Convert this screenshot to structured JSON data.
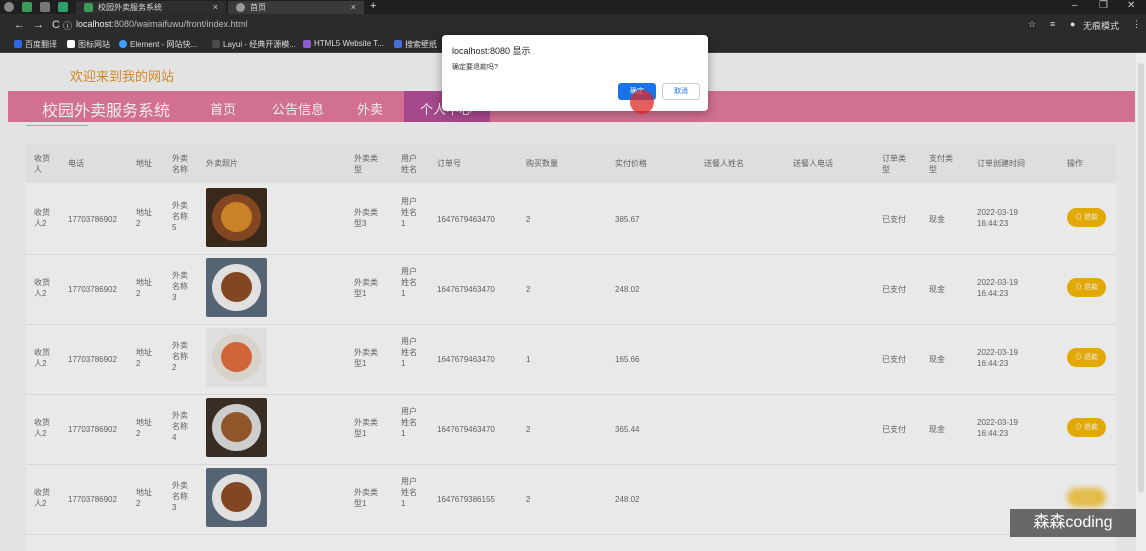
{
  "browser": {
    "tabs": [
      {
        "title": "校园外卖服务系统",
        "close": "×",
        "icon_color": "#3b9b5a"
      },
      {
        "title": "首页",
        "close": "×",
        "icon_color": "#999999"
      }
    ],
    "new_tab": "+",
    "url_host": "localhost",
    "url_rest": ":8080/waimaifuwu/front/index.html",
    "profile_label": "无痕模式",
    "window_controls": {
      "minimize": "–",
      "maximize": "❐",
      "close": "✕"
    },
    "bookmarks": [
      {
        "label": "百度翻译",
        "color": "#2d6ae3"
      },
      {
        "label": "图标网站",
        "color": "#ffffff"
      },
      {
        "label": "Element - 网站快...",
        "color": "#409eff"
      },
      {
        "label": "Layui - 经典开源模...",
        "color": "#4a4a4a"
      },
      {
        "label": "HTML5 Website T...",
        "color": "#8c5cd1"
      },
      {
        "label": "搜索壁纸",
        "color": "#4b6fd6"
      }
    ]
  },
  "page": {
    "welcome": "欢迎来到我的网站",
    "site_title": "校园外卖服务系统",
    "nav": [
      "首页",
      "公告信息",
      "外卖",
      "个人中心"
    ],
    "columns": [
      "收货人",
      "电话",
      "地址",
      "外卖名称",
      "外卖照片",
      "外卖类型",
      "用户姓名",
      "订单号",
      "购买数量",
      "实付价格",
      "送餐人姓名",
      "送餐人电话",
      "订单类型",
      "支付类型",
      "订单创建时间",
      "操作"
    ],
    "rows": [
      {
        "receiver": "收货人2",
        "phone": "17703786902",
        "address": "地址2",
        "name": "外卖名称5",
        "type": "外卖类型3",
        "user": "用户姓名1",
        "order_no": "1647679463470",
        "qty": "2",
        "price": "385.67",
        "order_type": "已支付",
        "pay_type": "现金",
        "date": "2022-03-19",
        "time": "16:44:23",
        "action": "退款",
        "photo_bg": "#3a2a1a",
        "plate": "#8a4a20",
        "food": "#d88a2a"
      },
      {
        "receiver": "收货人2",
        "phone": "17703786902",
        "address": "地址2",
        "name": "外卖名称3",
        "type": "外卖类型1",
        "user": "用户姓名1",
        "order_no": "1647679463470",
        "qty": "2",
        "price": "248.02",
        "order_type": "已支付",
        "pay_type": "现金",
        "date": "2022-03-19",
        "time": "16:44:23",
        "action": "退款",
        "photo_bg": "#5a6a7a",
        "plate": "#f0f0f0",
        "food": "#8a4a22"
      },
      {
        "receiver": "收货人2",
        "phone": "17703786902",
        "address": "地址2",
        "name": "外卖名称2",
        "type": "外卖类型1",
        "user": "用户姓名1",
        "order_no": "1647679463470",
        "qty": "1",
        "price": "165.66",
        "order_type": "已支付",
        "pay_type": "现金",
        "date": "2022-03-19",
        "time": "16:44:23",
        "action": "退款",
        "photo_bg": "#eeeeee",
        "plate": "#e8e2d8",
        "food": "#e06a3a"
      },
      {
        "receiver": "收货人2",
        "phone": "17703786902",
        "address": "地址2",
        "name": "外卖名称4",
        "type": "外卖类型1",
        "user": "用户姓名1",
        "order_no": "1647679463470",
        "qty": "2",
        "price": "365.44",
        "order_type": "已支付",
        "pay_type": "现金",
        "date": "2022-03-19",
        "time": "16:44:23",
        "action": "退款",
        "photo_bg": "#3a2e24",
        "plate": "#dcdcdc",
        "food": "#9a5a2a"
      },
      {
        "receiver": "收货人2",
        "phone": "17703786902",
        "address": "地址2",
        "name": "外卖名称3",
        "type": "外卖类型1",
        "user": "用户姓名1",
        "order_no": "1647679386155",
        "qty": "2",
        "price": "248.02",
        "order_type": "",
        "pay_type": "",
        "date": "",
        "time": "",
        "action": "",
        "photo_bg": "#5a6a7a",
        "plate": "#f0f0f0",
        "food": "#8a4a22"
      }
    ]
  },
  "dialog": {
    "title": "localhost:8080 显示",
    "message": "确定要退款吗?",
    "ok": "确定",
    "cancel": "取消"
  },
  "watermark": "森森coding",
  "colors": {
    "navbar": "#e0779a",
    "nav_active": "#b04c95",
    "pay_button": "#f2b300",
    "dialog_ok": "#1a73e8"
  }
}
